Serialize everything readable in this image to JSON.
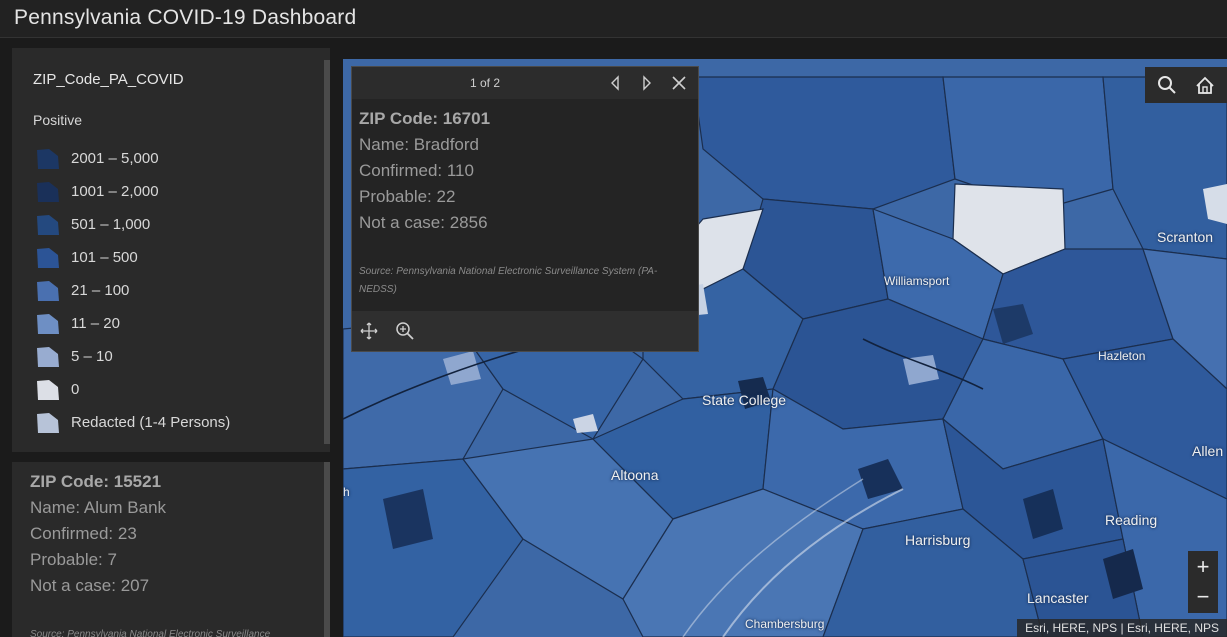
{
  "header": {
    "title": "Pennsylvania COVID-19 Dashboard"
  },
  "legend": {
    "layer_title": "ZIP_Code_PA_COVID",
    "field": "Positive",
    "items": [
      {
        "label": "2001 – 5,000",
        "color": "#1c3764"
      },
      {
        "label": "1001 – 2,000",
        "color": "#1a3059"
      },
      {
        "label": "501 – 1,000",
        "color": "#24497f"
      },
      {
        "label": "101 – 500",
        "color": "#2c5496"
      },
      {
        "label": "21 – 100",
        "color": "#4a70b0"
      },
      {
        "label": "11 – 20",
        "color": "#6e8fc4"
      },
      {
        "label": "5 – 10",
        "color": "#98acd0"
      },
      {
        "label": "0",
        "color": "#dcdfe6"
      },
      {
        "label": "Redacted (1-4 Persons)",
        "color": "#b7c3d8"
      }
    ]
  },
  "side_info": {
    "zip": "ZIP Code: 15521",
    "name": "Name: Alum Bank",
    "confirmed": "Confirmed: 23",
    "probable": "Probable: 7",
    "not_case": "Not a case: 207",
    "source": "Source: Pennsylvania National Electronic Surveillance"
  },
  "popup": {
    "pager": "1 of 2",
    "zip": "ZIP Code: 16701",
    "name": "Name: Bradford",
    "confirmed": "Confirmed: 110",
    "probable": "Probable: 22",
    "not_case": "Not a case: 2856",
    "source": "Source: Pennsylvania National Electronic Surveillance System (PA-NEDSS)",
    "icons": [
      "chevron-left-icon",
      "chevron-right-icon",
      "close-icon",
      "pan-to-icon",
      "zoom-to-icon"
    ]
  },
  "map": {
    "cities": [
      "Scranton",
      "Williamsport",
      "Hazleton",
      "State College",
      "Allen",
      "Altoona",
      "Reading",
      "Harrisburg",
      "Lancaster",
      "Chambersburg"
    ],
    "edge_letter": "h",
    "attribution": "Esri, HERE, NPS | Esri, HERE, NPS",
    "zoom_in": "+",
    "zoom_out": "−",
    "tool_icons": [
      "search-icon",
      "home-icon"
    ]
  }
}
